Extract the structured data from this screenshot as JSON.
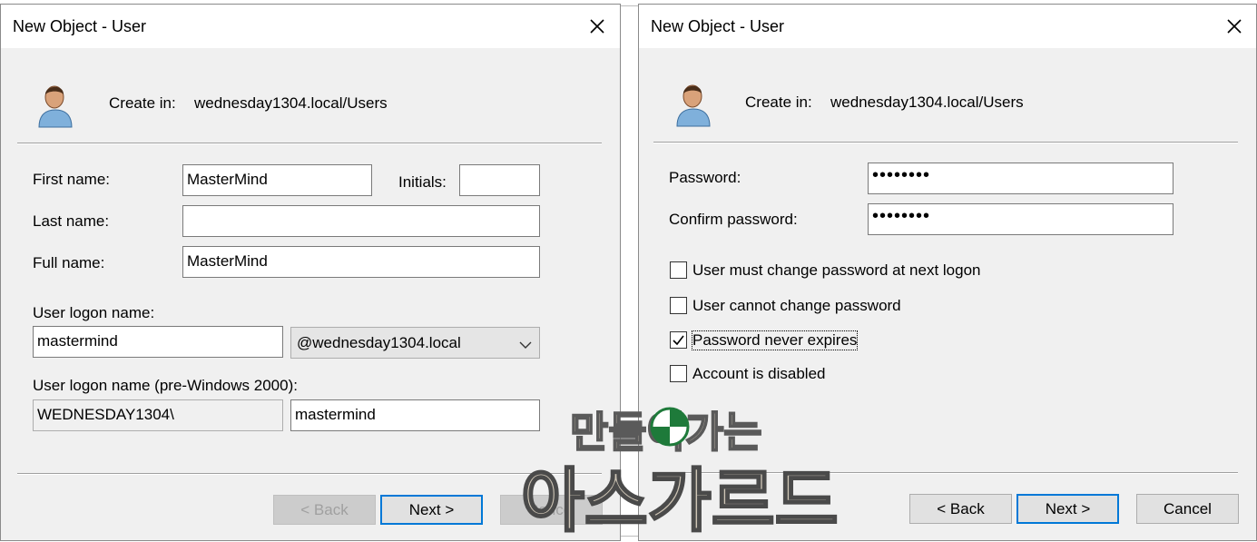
{
  "dialog1": {
    "title": "New Object - User",
    "create_in_label": "Create in:",
    "create_in_value": "wednesday1304.local/Users",
    "first_name_label": "First name:",
    "first_name_value": "MasterMind",
    "initials_label": "Initials:",
    "initials_value": "",
    "last_name_label": "Last name:",
    "last_name_value": "",
    "full_name_label": "Full name:",
    "full_name_value": "MasterMind",
    "logon_name_label": "User logon name:",
    "logon_name_value": "mastermind",
    "domain_select_value": "@wednesday1304.local",
    "pre2000_label": "User logon name (pre-Windows 2000):",
    "pre2000_domain_value": "WEDNESDAY1304\\",
    "pre2000_user_value": "mastermind",
    "back_label": "< Back",
    "next_label": "Next >",
    "cancel_label": "Cancel"
  },
  "dialog2": {
    "title": "New Object - User",
    "create_in_label": "Create in:",
    "create_in_value": "wednesday1304.local/Users",
    "password_label": "Password:",
    "password_value": "••••••••",
    "confirm_label": "Confirm password:",
    "confirm_value": "••••••••",
    "options": [
      {
        "label": "User must change password at next logon",
        "checked": false
      },
      {
        "label": "User cannot change password",
        "checked": false
      },
      {
        "label": "Password never expires",
        "checked": true
      },
      {
        "label": "Account is disabled",
        "checked": false
      }
    ],
    "back_label": "< Back",
    "next_label": "Next >",
    "cancel_label": "Cancel"
  },
  "watermark": {
    "line1": "만들어가는",
    "line2": "아스가르드"
  },
  "colors": {
    "dialog_bg": "#f0f0f0",
    "focus_border": "#0078d7"
  }
}
